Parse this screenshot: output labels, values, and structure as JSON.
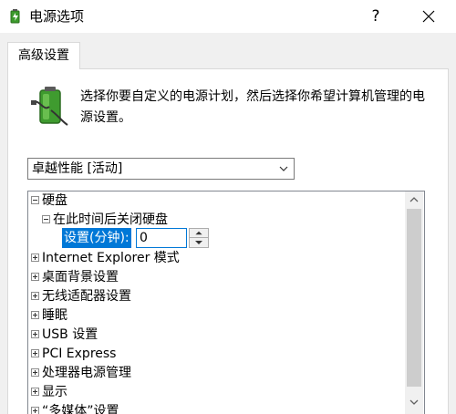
{
  "window": {
    "title": "电源选项",
    "title_icon": "power-options-icon",
    "help_label": "?",
    "close_icon": "close-icon"
  },
  "tab": {
    "label": "高级设置"
  },
  "description": {
    "icon": "battery-icon",
    "text": "选择你要自定义的电源计划，然后选择你希望计算机管理的电源设置。"
  },
  "plan_select": {
    "value": "卓越性能 [活动]",
    "icon": "chevron-down-icon"
  },
  "tree": {
    "items": [
      {
        "label": "硬盘",
        "expanded": true
      },
      {
        "label": "在此时间后关闭硬盘",
        "expanded": true
      },
      {
        "label": "设置(分钟):",
        "value": "0"
      },
      {
        "label": "Internet Explorer 模式",
        "expanded": false
      },
      {
        "label": "桌面背景设置",
        "expanded": false
      },
      {
        "label": "无线适配器设置",
        "expanded": false
      },
      {
        "label": "睡眠",
        "expanded": false
      },
      {
        "label": "USB 设置",
        "expanded": false
      },
      {
        "label": "PCI Express",
        "expanded": false
      },
      {
        "label": "处理器电源管理",
        "expanded": false
      },
      {
        "label": "显示",
        "expanded": false
      },
      {
        "label": "“多媒体”设置",
        "expanded": false
      }
    ]
  },
  "colors": {
    "selection": "#0078d7",
    "panel_bg": "#f0f0f0",
    "scroll_thumb": "#cdcdcd"
  }
}
